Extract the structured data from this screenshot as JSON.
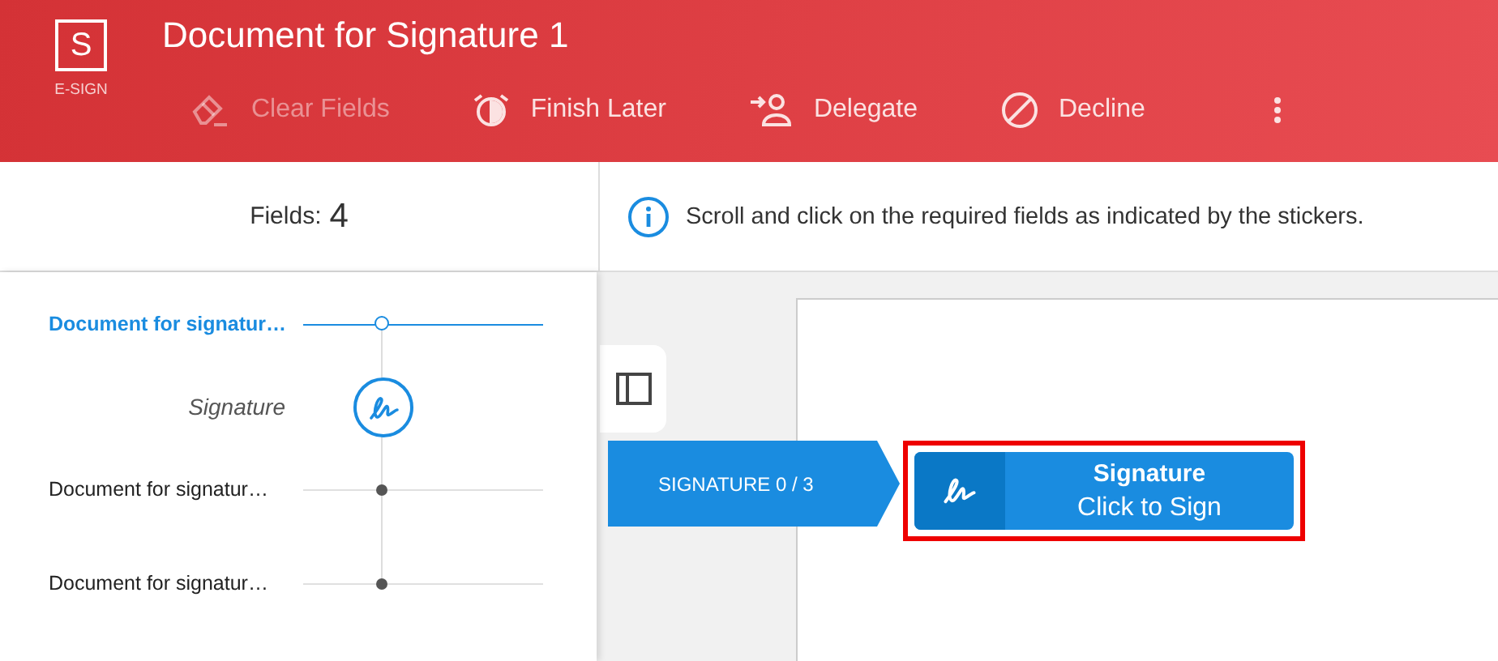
{
  "app": {
    "logo": "S",
    "name": "E-SIGN"
  },
  "document_title": "Document for Signature 1",
  "toolbar": [
    {
      "kind": "clear",
      "label": "Clear Fields",
      "disabled": true
    },
    {
      "kind": "later",
      "label": "Finish Later",
      "disabled": false
    },
    {
      "kind": "delegate",
      "label": "Delegate",
      "disabled": false
    },
    {
      "kind": "decline",
      "label": "Decline",
      "disabled": false
    }
  ],
  "fields": {
    "label": "Fields:",
    "count": "4"
  },
  "info": "Scroll and click on the required fields as indicated by the stickers.",
  "outline": [
    {
      "kind": "section",
      "label": "Document for signatur…",
      "selected": true
    },
    {
      "kind": "field",
      "label": "Signature",
      "selected": false
    },
    {
      "kind": "section",
      "label": "Document for signatur…",
      "selected": false
    },
    {
      "kind": "section",
      "label": "Document for signatur…",
      "selected": false
    }
  ],
  "sticker": {
    "label": "SIGNATURE 0 / 3"
  },
  "signature_field": {
    "title": "Signature",
    "action": "Click to Sign",
    "highlighted": true
  }
}
